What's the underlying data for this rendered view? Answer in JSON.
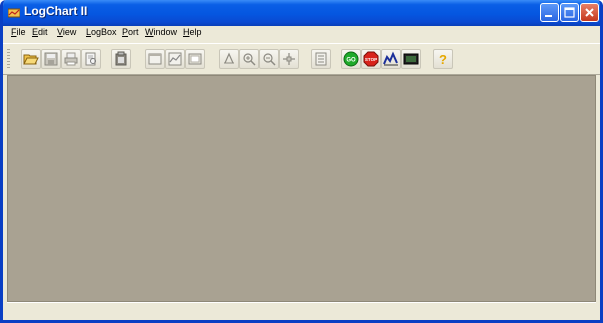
{
  "window": {
    "title": "LogChart II",
    "controls": {
      "minimize": "minimize",
      "maximize": "maximize",
      "close": "close"
    }
  },
  "menu": [
    {
      "label": "File",
      "key": "F",
      "rest": "ile"
    },
    {
      "label": "Edit",
      "key": "E",
      "rest": "dit"
    },
    {
      "label": "View",
      "key": "V",
      "rest": "iew"
    },
    {
      "label": "LogBox",
      "key": "L",
      "rest": "ogBox"
    },
    {
      "label": "Port",
      "key": "P",
      "rest": "ort"
    },
    {
      "label": "Window",
      "key": "W",
      "rest": "indow"
    },
    {
      "label": "Help",
      "key": "H",
      "rest": "elp"
    }
  ],
  "toolbar": {
    "go_label": "GO",
    "stop_label": "STOP",
    "help_label": "?",
    "icons": [
      "open-folder-icon",
      "save-icon",
      "print-icon",
      "print-preview-icon",
      "clipboard-icon",
      "window-icon",
      "chart-icon",
      "panel-icon",
      "zoom-fit-icon",
      "zoom-in-icon",
      "zoom-out-icon",
      "pan-icon",
      "list-icon",
      "go-icon",
      "stop-icon",
      "graph-icon",
      "display-icon",
      "help-icon"
    ]
  },
  "status_bar": {
    "text": ""
  },
  "colors": {
    "titlebar": "#0556e0",
    "workspace": "#a9a292",
    "chrome": "#ece9d8"
  }
}
